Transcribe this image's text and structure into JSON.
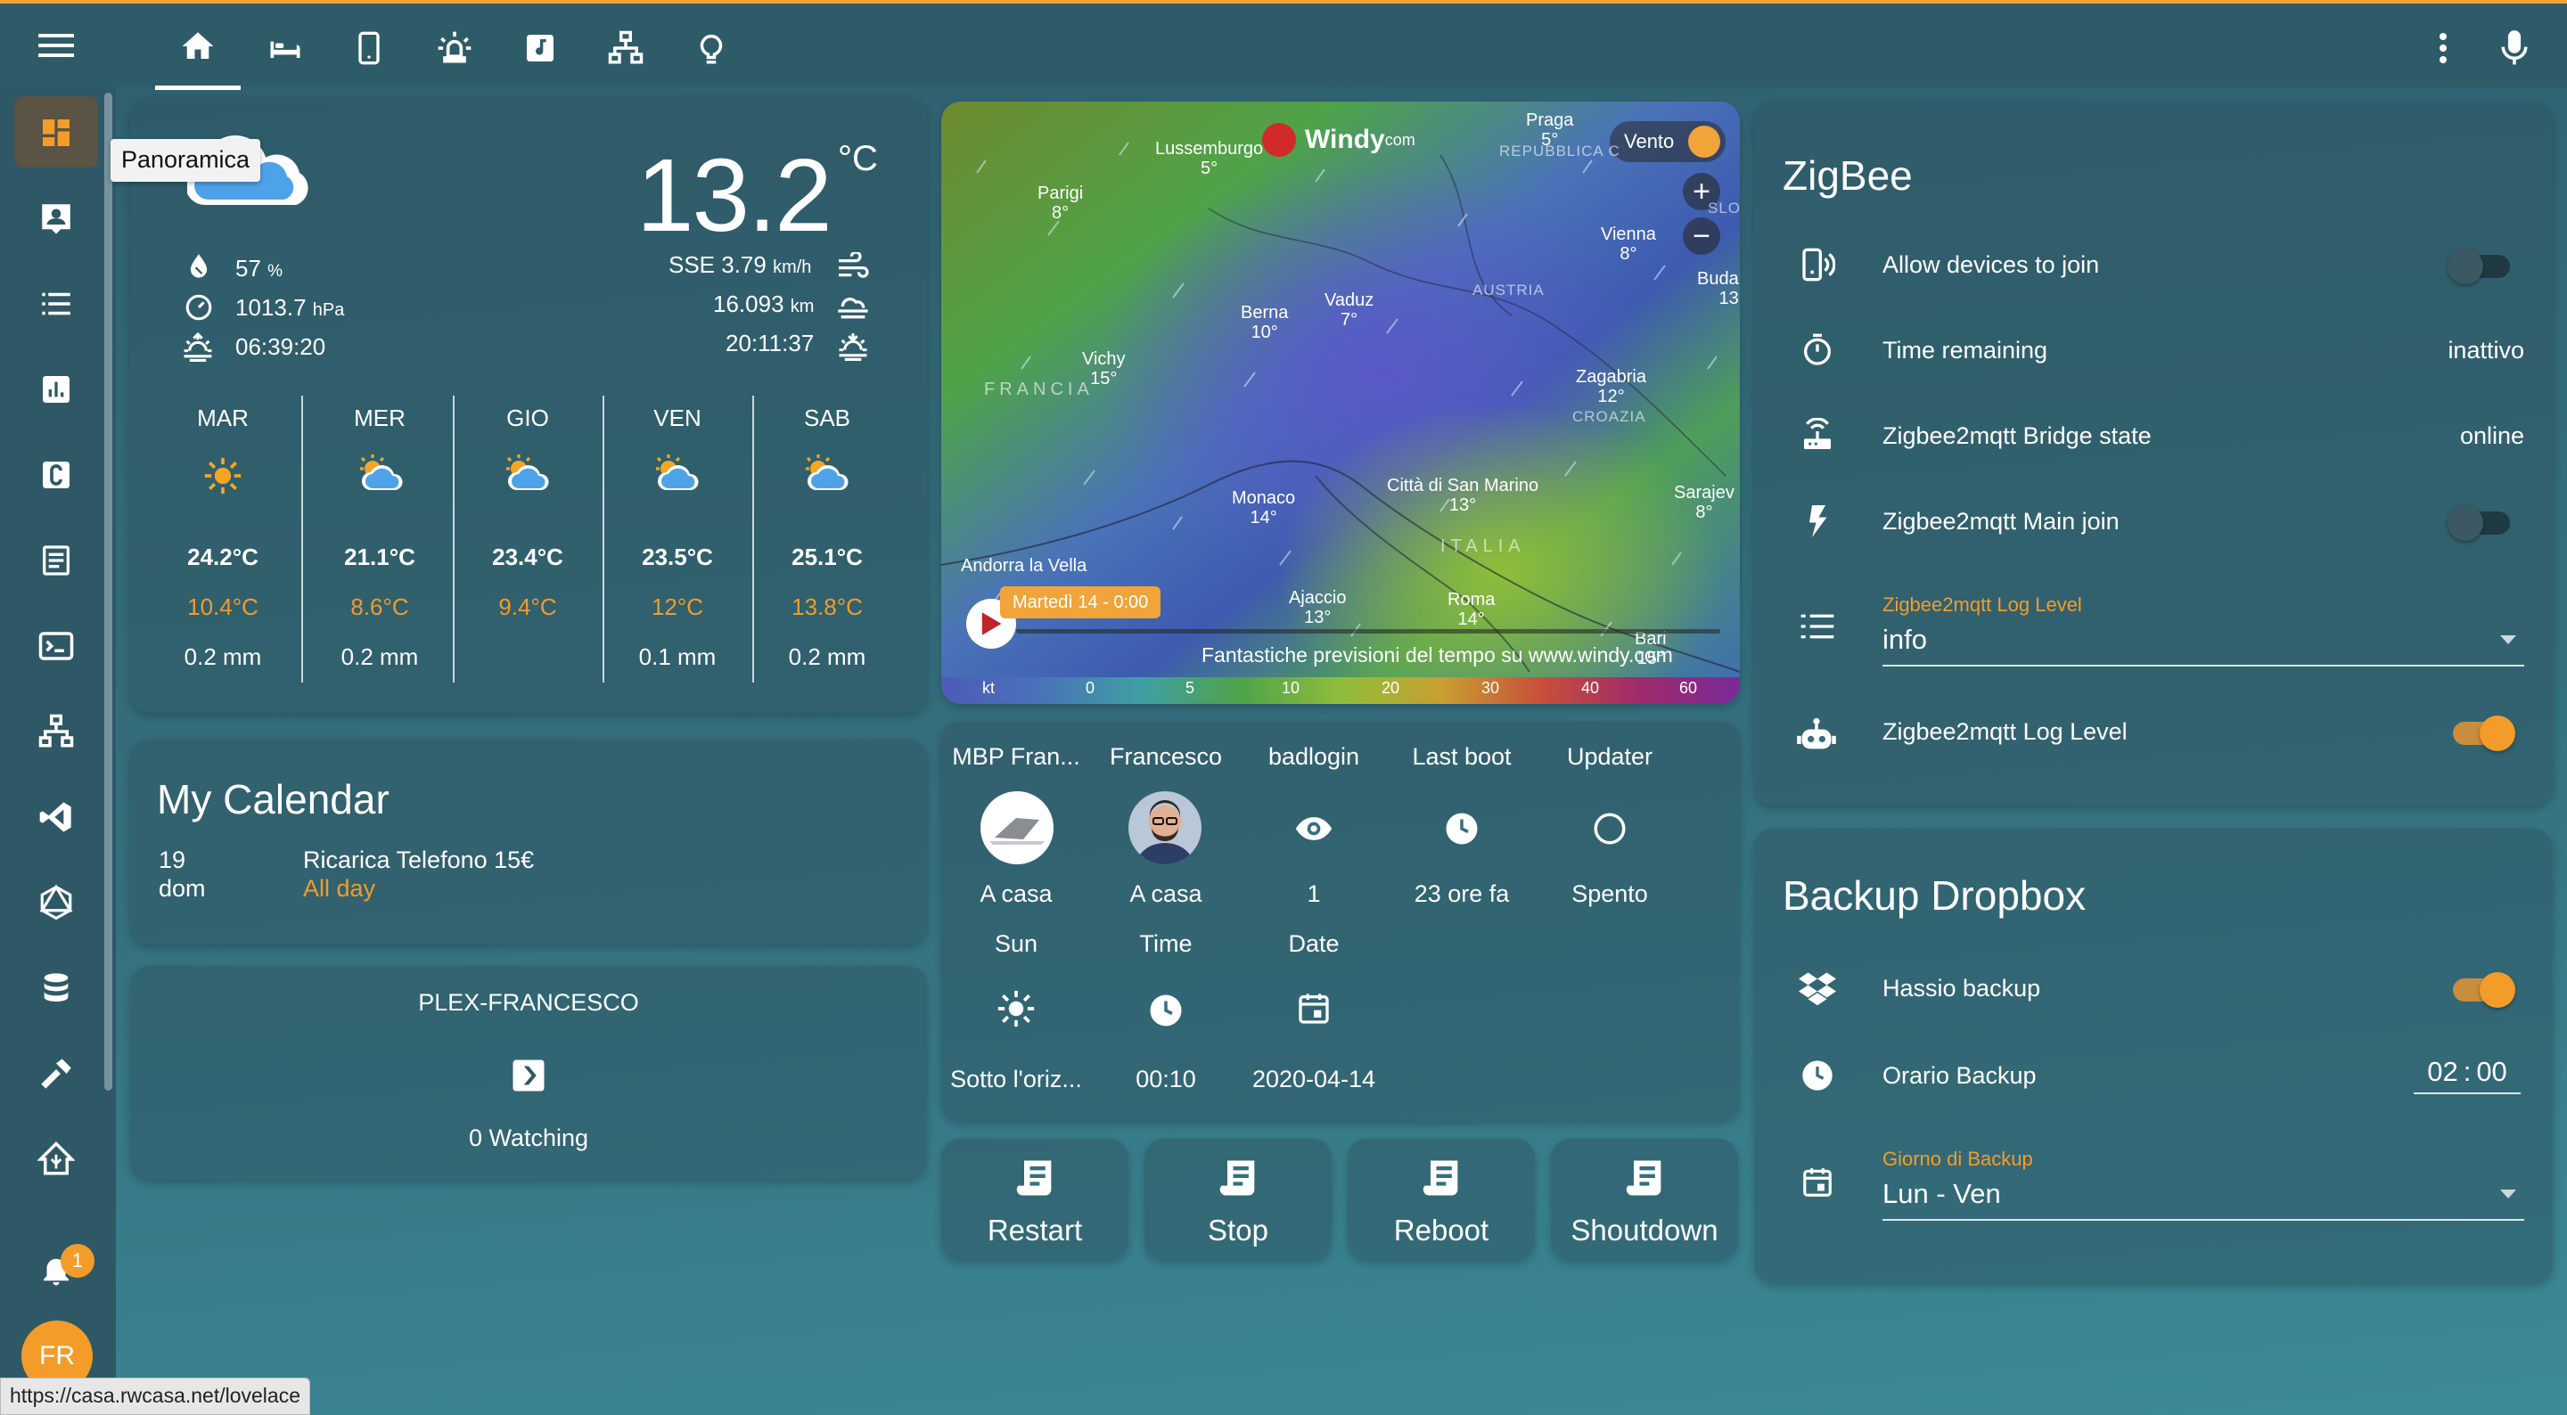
{
  "topbar": {
    "tabs": [
      "home-icon",
      "bed-icon",
      "phone-icon",
      "alarm-light-icon",
      "music-icon",
      "network-icon",
      "lightbulb-icon"
    ],
    "menu_icon": "hamburger-icon",
    "more_icon": "dots-vertical-icon",
    "mic_icon": "microphone-icon"
  },
  "sidebar": {
    "items": [
      "dashboard-icon",
      "account-box-icon",
      "list-icon",
      "chart-icon",
      "c-box-icon",
      "logbook-icon",
      "terminal-icon",
      "network-icon",
      "vscode-icon",
      "graphql-icon",
      "database-icon",
      "hammer-icon",
      "home-assistant-icon"
    ],
    "tooltip": "Panoramica",
    "notifications_count": "1",
    "avatar_initials": "FR"
  },
  "weather": {
    "temp": "13.2",
    "unit": "°C",
    "humidity": "57",
    "humidity_unit": "%",
    "pressure": "1013.7",
    "pressure_unit": "hPa",
    "sunrise": "06:39:20",
    "wind": "SSE 3.79",
    "wind_unit": "km/h",
    "visibility": "16.093",
    "visibility_unit": "km",
    "sunset": "20:11:37",
    "forecast": [
      {
        "day": "MAR",
        "high": "24.2°C",
        "low": "10.4°C",
        "precip": "0.2 mm",
        "icon": "sunny-icon"
      },
      {
        "day": "MER",
        "high": "21.1°C",
        "low": "8.6°C",
        "precip": "0.2 mm",
        "icon": "partly-cloudy-icon"
      },
      {
        "day": "GIO",
        "high": "23.4°C",
        "low": "9.4°C",
        "precip": "",
        "icon": "partly-cloudy-icon"
      },
      {
        "day": "VEN",
        "high": "23.5°C",
        "low": "12°C",
        "precip": "0.1 mm",
        "icon": "partly-cloudy-icon"
      },
      {
        "day": "SAB",
        "high": "25.1°C",
        "low": "13.8°C",
        "precip": "0.2 mm",
        "icon": "partly-cloudy-icon"
      }
    ]
  },
  "calendar": {
    "title": "My Calendar",
    "date_num": "19",
    "date_day": "dom",
    "event": "Ricarica Telefono 15€",
    "event_time": "All day"
  },
  "plex": {
    "title": "PLEX-FRANCESCO",
    "watching": "0 Watching"
  },
  "map": {
    "brand": "Windy",
    "brand_suffix": "com",
    "layer": "Vento",
    "play_label": "Martedì 14 - 0:00",
    "footer": "Fantastiche previsioni del tempo su www.windy.com",
    "scale": [
      "kt",
      "0",
      "5",
      "10",
      "20",
      "30",
      "40",
      "60"
    ],
    "cities": [
      [
        "Lussemburgo",
        "5°"
      ],
      [
        "Praga",
        "5°"
      ],
      [
        "Parigi",
        "8°"
      ],
      [
        "Vienna",
        "8°"
      ],
      [
        "Buda",
        "13"
      ],
      [
        "Vaduz",
        "7°"
      ],
      [
        "Berna",
        "10°"
      ],
      [
        "Vichy",
        "15°"
      ],
      [
        "Zagabria",
        "12°"
      ],
      [
        "Monaco",
        "14°"
      ],
      [
        "Città di San Marino",
        "13°"
      ],
      [
        "Sarajev",
        "8°"
      ],
      [
        "Andorra la Vella",
        ""
      ],
      [
        "Ajaccio",
        "13°"
      ],
      [
        "Roma",
        "14°"
      ],
      [
        "Bari",
        "15°"
      ]
    ],
    "regions": [
      "REPUBBLICA C",
      "AUSTRIA",
      "FRANCIA",
      "CROAZIA",
      "ITALIA",
      "SLO"
    ]
  },
  "entities": {
    "row1": [
      {
        "name": "MBP Fran...",
        "state": "A casa"
      },
      {
        "name": "Francesco",
        "state": "A casa"
      },
      {
        "name": "badlogin",
        "state": "1"
      },
      {
        "name": "Last boot",
        "state": "23 ore fa"
      },
      {
        "name": "Updater",
        "state": "Spento"
      }
    ],
    "row2": [
      {
        "name": "Sun",
        "state": "Sotto l'oriz..."
      },
      {
        "name": "Time",
        "state": "00:10"
      },
      {
        "name": "Date",
        "state": "2020-04-14"
      }
    ]
  },
  "buttons": [
    "Restart",
    "Stop",
    "Reboot",
    "Shoutdown"
  ],
  "zigbee": {
    "title": "ZigBee",
    "rows": [
      {
        "label": "Allow devices to join",
        "type": "toggle",
        "on": false
      },
      {
        "label": "Time remaining",
        "value": "inattivo"
      },
      {
        "label": "Zigbee2mqtt Bridge state",
        "value": "online"
      },
      {
        "label": "Zigbee2mqtt Main join",
        "type": "toggle",
        "on": false
      }
    ],
    "select_label": "Zigbee2mqtt Log Level",
    "select_value": "info",
    "toggle_label": "Zigbee2mqtt Log Level"
  },
  "backup": {
    "title": "Backup Dropbox",
    "hassio": "Hassio backup",
    "orario": "Orario Backup",
    "hh": "02",
    "mm": "00",
    "giorno_label": "Giorno di Backup",
    "giorno_value": "Lun - Ven"
  },
  "status_url": "https://casa.rwcasa.net/lovelace",
  "accent": "#f39c29"
}
